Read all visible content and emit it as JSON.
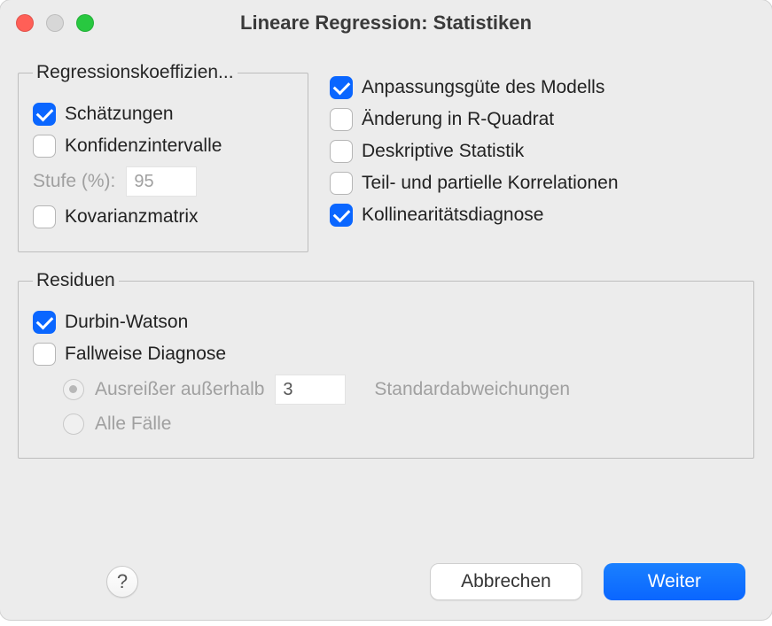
{
  "window": {
    "title": "Lineare Regression: Statistiken"
  },
  "coeff": {
    "legend": "Regressionskoeffizien...",
    "estimates": {
      "label": "Schätzungen",
      "checked": true
    },
    "confint": {
      "label": "Konfidenzintervalle",
      "checked": false
    },
    "level_label": "Stufe (%):",
    "level_value": "95",
    "covmat": {
      "label": "Kovarianzmatrix",
      "checked": false
    }
  },
  "right": {
    "fit": {
      "label": "Anpassungsgüte des Modells",
      "checked": true
    },
    "r2change": {
      "label": "Änderung in R-Quadrat",
      "checked": false
    },
    "descr": {
      "label": "Deskriptive Statistik",
      "checked": false
    },
    "partcorr": {
      "label": "Teil- und partielle Korrelationen",
      "checked": false
    },
    "collin": {
      "label": "Kollinearitätsdiagnose",
      "checked": true
    }
  },
  "residuals": {
    "legend": "Residuen",
    "durbin": {
      "label": "Durbin-Watson",
      "checked": true
    },
    "casewise": {
      "label": "Fallweise Diagnose",
      "checked": false
    },
    "outliers": {
      "label": "Ausreißer außerhalb",
      "value": "3",
      "std_label": "Standardabweichungen"
    },
    "allcases": {
      "label": "Alle Fälle"
    }
  },
  "footer": {
    "help": "?",
    "cancel": "Abbrechen",
    "continue": "Weiter"
  }
}
